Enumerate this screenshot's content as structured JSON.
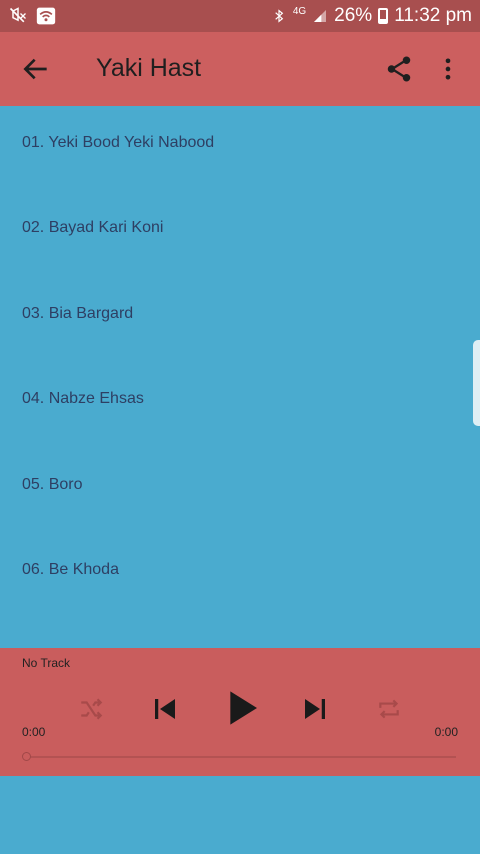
{
  "status_bar": {
    "battery": "26%",
    "time": "11:32 pm",
    "network": "4G"
  },
  "app_bar": {
    "title": "Yaki Hast"
  },
  "tracks": [
    "01. Yeki Bood Yeki Nabood",
    "02. Bayad Kari Koni",
    "03. Bia Bargard",
    "04. Nabze Ehsas",
    "05. Boro",
    "06. Be Khoda"
  ],
  "player": {
    "now_playing": "No Track",
    "elapsed": "0:00",
    "duration": "0:00",
    "progress": 0
  },
  "colors": {
    "status_bar": "#a84f4f",
    "app_bar": "#cc5f5f",
    "background": "#4aabcf",
    "player": "#c95d5d",
    "track_text": "#2e3f63"
  }
}
